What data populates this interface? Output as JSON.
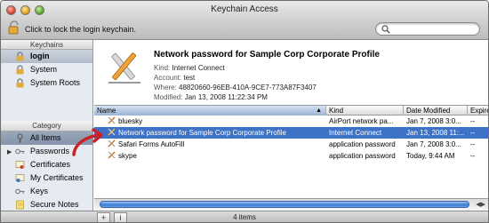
{
  "window": {
    "title": "Keychain Access"
  },
  "toolbar": {
    "lock_hint": "Click to lock the login keychain.",
    "search_placeholder": ""
  },
  "sidebar": {
    "keychains_header": "Keychains",
    "keychains": [
      {
        "label": "login",
        "icon": "lock-icon",
        "selected": true
      },
      {
        "label": "System",
        "icon": "lock-icon"
      },
      {
        "label": "System Roots",
        "icon": "lock-icon"
      }
    ],
    "category_header": "Category",
    "categories": [
      {
        "label": "All Items",
        "icon": "all-items-icon",
        "active": true
      },
      {
        "label": "Passwords",
        "icon": "key-icon",
        "expandable": true
      },
      {
        "label": "Certificates",
        "icon": "certificate-icon"
      },
      {
        "label": "My Certificates",
        "icon": "my-certificate-icon"
      },
      {
        "label": "Keys",
        "icon": "key-icon"
      },
      {
        "label": "Secure Notes",
        "icon": "note-icon"
      }
    ]
  },
  "info": {
    "name": "Network password for Sample Corp Corporate Profile",
    "kind_label": "Kind:",
    "kind": "Internet Connect",
    "account_label": "Account:",
    "account": "test",
    "where_label": "Where:",
    "where": "48820660-96EB-410A-9CE7-773A87F3407",
    "modified_label": "Modified:",
    "modified": "Jan 13, 2008 11:22:34 PM"
  },
  "table": {
    "columns": [
      "Name",
      "Kind",
      "Date Modified",
      "Expire"
    ],
    "rows": [
      {
        "name": "bluesky",
        "kind": "AirPort network pa...",
        "date": "Jan 7, 2008 3:0...",
        "expires": "--"
      },
      {
        "name": "Network password for Sample Corp Corporate Profile",
        "kind": "Internet Connect",
        "date": "Jan 13, 2008 11:...",
        "expires": "--",
        "selected": true
      },
      {
        "name": "Safari Forms AutoFill",
        "kind": "application password",
        "date": "Jan 7, 2008 3:0...",
        "expires": "--"
      },
      {
        "name": "skype",
        "kind": "application password",
        "date": "Today, 9:44 AM",
        "expires": "--"
      }
    ]
  },
  "footer": {
    "add_label": "+",
    "info_label": "i",
    "item_count": "4 items"
  },
  "colors": {
    "selection": "#3d72c7",
    "annotation_arrow": "#c8232c"
  }
}
